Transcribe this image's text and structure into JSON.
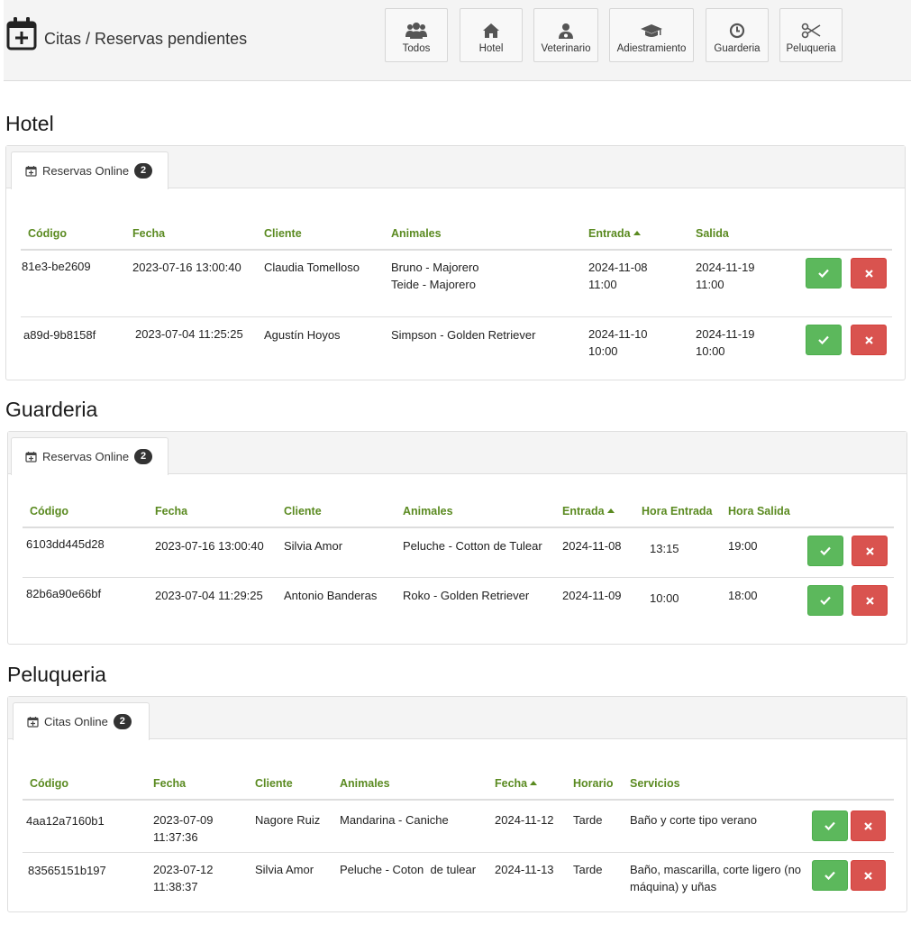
{
  "header": {
    "title": "Citas / Reservas pendientes",
    "icon": "calendar-plus-icon",
    "filters": [
      {
        "label": "Todos",
        "icon": "users-icon"
      },
      {
        "label": "Hotel",
        "icon": "home-icon"
      },
      {
        "label": "Veterinario",
        "icon": "user-doctor-icon"
      },
      {
        "label": "Adiestramiento",
        "icon": "graduation-cap-icon"
      },
      {
        "label": "Guarderia",
        "icon": "clock-icon"
      },
      {
        "label": "Peluqueria",
        "icon": "scissors-icon"
      }
    ]
  },
  "colors": {
    "accent_green": "#5a8a20",
    "accept": "#5cb85c",
    "reject": "#d9534f"
  },
  "hotel": {
    "title": "Hotel",
    "tab": {
      "label": "Reservas Online",
      "count": "2"
    },
    "columns": {
      "codigo": "Código",
      "fecha": "Fecha",
      "cliente": "Cliente",
      "animales": "Animales",
      "entrada": "Entrada",
      "salida": "Salida"
    },
    "rows": [
      {
        "codigo": "81e3-be2609",
        "fecha": "2023-07-16 13:00:40",
        "cliente": "Claudia Tomelloso",
        "animales": [
          "Bruno - Majorero",
          "Teide - Majorero"
        ],
        "entrada": [
          "2024-11-08",
          "11:00"
        ],
        "salida": [
          "2024-11-19",
          "11:00"
        ]
      },
      {
        "codigo": "a89d-9b8158f",
        "fecha": "2023-07-04 11:25:25",
        "cliente": "Agustín Hoyos",
        "animales": [
          "Simpson - Golden Retriever"
        ],
        "entrada": [
          "2024-11-10",
          "10:00"
        ],
        "salida": [
          "2024-11-19",
          "10:00"
        ]
      }
    ]
  },
  "guarderia": {
    "title": "Guarderia",
    "tab": {
      "label": "Reservas Online",
      "count": "2"
    },
    "columns": {
      "codigo": "Código",
      "fecha": "Fecha",
      "cliente": "Cliente",
      "animales": "Animales",
      "entrada": "Entrada",
      "hora_entrada": "Hora Entrada",
      "hora_salida": "Hora Salida"
    },
    "rows": [
      {
        "codigo": "6103dd445d28",
        "fecha": "2023-07-16 13:00:40",
        "cliente": "Silvia Amor",
        "animales": "Peluche - Cotton de Tulear",
        "entrada": "2024-11-08",
        "hora_entrada": "13:15",
        "hora_salida": "19:00"
      },
      {
        "codigo": "82b6a90e66bf",
        "fecha": "2023-07-04 11:29:25",
        "cliente": "Antonio Banderas",
        "animales": "Roko - Golden Retriever",
        "entrada": "2024-11-09",
        "hora_entrada": "10:00",
        "hora_salida": "18:00"
      }
    ]
  },
  "peluqueria": {
    "title": "Peluqueria",
    "tab": {
      "label": "Citas Online",
      "count": "2"
    },
    "columns": {
      "codigo": "Código",
      "fecha": "Fecha",
      "cliente": "Cliente",
      "animales": "Animales",
      "fecha_cita": "Fecha",
      "horario": "Horario",
      "servicios": "Servicios"
    },
    "rows": [
      {
        "codigo": "4aa12a7160b1",
        "fecha": [
          "2023-07-09",
          "11:37:36"
        ],
        "cliente": "Nagore Ruiz",
        "animales": "Mandarina - Caniche",
        "fecha_cita": "2024-11-12",
        "horario": "Tarde",
        "servicios": [
          "Baño y corte tipo verano"
        ]
      },
      {
        "codigo": "83565151b197",
        "fecha": [
          "2023-07-12",
          "11:38:37"
        ],
        "cliente": "Silvia Amor",
        "animales": "Peluche - Coton  de tulear",
        "fecha_cita": "2024-11-13",
        "horario": "Tarde",
        "servicios": [
          "Baño, mascarilla, corte ligero (no",
          "máquina) y uñas"
        ]
      }
    ]
  }
}
